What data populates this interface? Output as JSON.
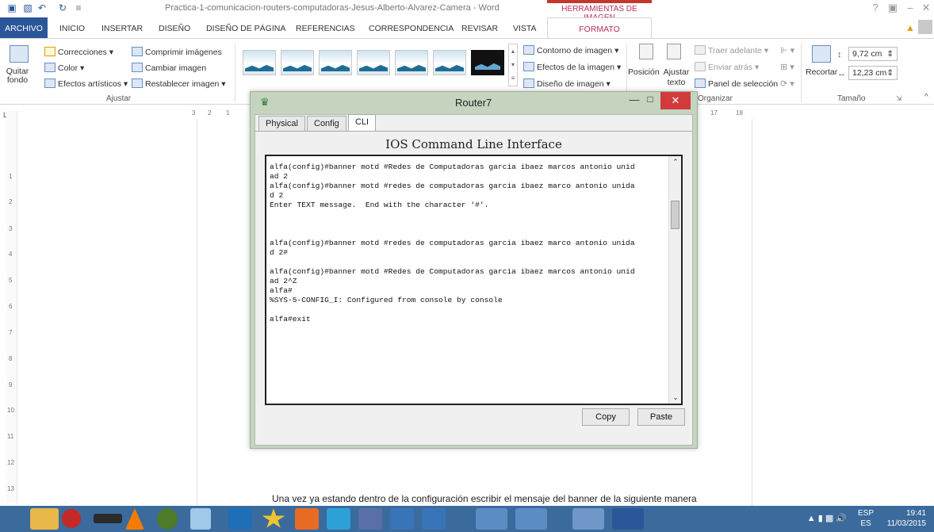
{
  "word": {
    "doc_title": "Practica-1-comunicacion-routers-computadoras-Jesus-Alberto-Alvarez-Camera - Word",
    "contextual_tab": "HERRAMIENTAS DE IMAGEN",
    "tabs": [
      "ARCHIVO",
      "INICIO",
      "INSERTAR",
      "DISEÑO",
      "DISEÑO DE PÁGINA",
      "REFERENCIAS",
      "CORRESPONDENCIA",
      "REVISAR",
      "VISTA"
    ],
    "active_tab": "FORMATO",
    "ribbon": {
      "quitar_fondo": "Quitar fondo",
      "correcciones": "Correcciones",
      "color": "Color",
      "efectos_artisticos": "Efectos artísticos",
      "comprimir": "Comprimir imágenes",
      "cambiar": "Cambiar imagen",
      "restablecer": "Restablecer imagen",
      "group_ajustar": "Ajustar",
      "contorno": "Contorno de imagen",
      "efectos": "Efectos de la imagen",
      "diseno": "Diseño de imagen",
      "posicion": "Posición",
      "ajustar_texto": "Ajustar texto",
      "traer": "Traer adelante",
      "enviar": "Enviar atrás",
      "panel": "Panel de selección",
      "group_organizar": "Organizar",
      "recortar": "Recortar",
      "height": "9,72 cm",
      "width": "12,23 cm",
      "group_tamano": "Tamaño"
    },
    "ruler_h": [
      "3",
      "2",
      "1",
      "17",
      "18"
    ],
    "ruler_v": [
      "1",
      "2",
      "3",
      "4",
      "5",
      "6",
      "7",
      "8",
      "9",
      "10",
      "11",
      "12",
      "13"
    ],
    "body_text": "Una vez ya estando dentro de la configuración escribir el mensaje del banner de la siguiente manera"
  },
  "router": {
    "title": "Router7",
    "tabs": [
      "Physical",
      "Config",
      "CLI"
    ],
    "active_tab": "CLI",
    "cli_title": "IOS Command Line Interface",
    "cli_output": "alfa(config)#banner motd #Redes de Computadoras garcia ibaez marcos antonio unid\nad 2\nalfa(config)#banner motd #redes de computadoras garcia ibaez marco antonio unida\nd 2\nEnter TEXT message.  End with the character '#'.\n\n\n\nalfa(config)#banner motd #redes de computadoras garcia ibaez marco antonio unida\nd 2#\n\nalfa(config)#banner motd #Redes de Computadoras garcia ibaez marcos antonio unid\nad 2^Z\nalfa#\n%SYS-5-CONFIG_I: Configured from console by console\n\nalfa#exit",
    "copy_label": "Copy",
    "paste_label": "Paste"
  },
  "taskbar": {
    "lang_top": "ESP",
    "lang_bottom": "ES",
    "time": "19:41",
    "date": "11/03/2015"
  }
}
